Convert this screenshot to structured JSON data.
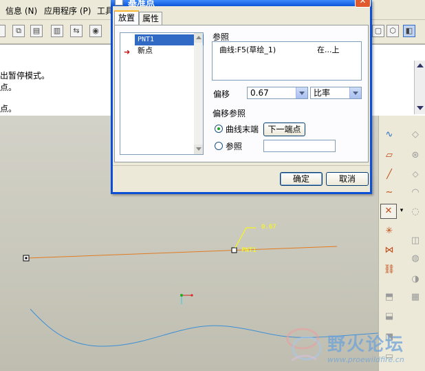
{
  "menubar": {
    "items": [
      "信息 (N)",
      "应用程序 (P)",
      "工具"
    ]
  },
  "messages": [
    "出暂停模式。",
    "点。",
    "点。"
  ],
  "dialog": {
    "title": "基准点",
    "close_glyph": "✕",
    "tabs": [
      "放置",
      "属性"
    ],
    "active_tab": 0,
    "points": [
      {
        "label": "PNT1",
        "selected": true
      },
      {
        "label": "新点",
        "selected": false
      }
    ],
    "reference_label": "参照",
    "reference_entry": {
      "name": "曲线:F5(草绘_1)",
      "type": "在...上"
    },
    "offset_label": "偏移",
    "offset_value": "0.67",
    "offset_type": "比率",
    "offset_ref_label": "偏移参照",
    "radio_curve_end": "曲线末端",
    "radio_curve_end_checked": true,
    "next_endpoint_button": "下一端点",
    "radio_reference": "参照",
    "ok_button": "确定",
    "cancel_button": "取消"
  },
  "graphics": {
    "dimension_value": "0.67",
    "point_label": "PNT1",
    "line_color": "#e07b20",
    "curve_color": "#3b8fd6"
  },
  "watermark": {
    "title": "野火论坛",
    "url": "www.proewildfire.cn"
  }
}
